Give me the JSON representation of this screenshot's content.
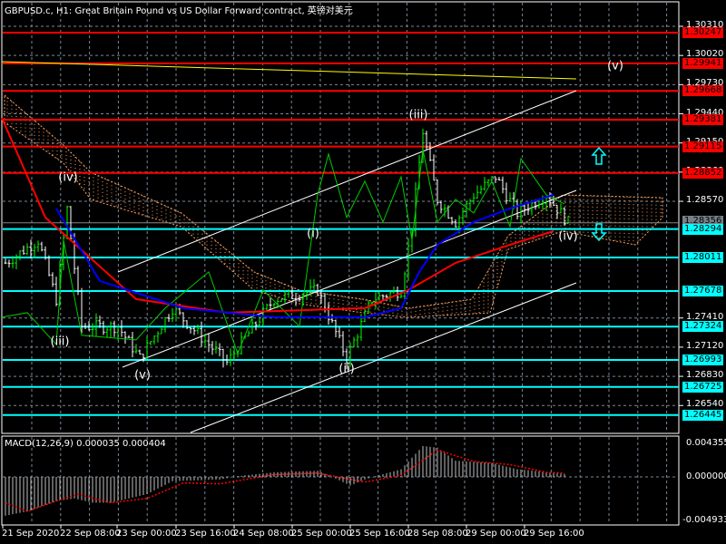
{
  "header": {
    "title": "GBPUSD.c, H1:  Great Britain Pound vs US Dollar Forward contract, 英镑对美元"
  },
  "colors": {
    "resistance": "#ff0000",
    "support": "#00ffff",
    "up_bar": "#00ff00",
    "down_bar": "#ffffff",
    "ma_slow": "#ff0000",
    "ma_fast": "#0000ff",
    "cloud": "#ffa060",
    "trendline": "#ffff00"
  },
  "price_axis": {
    "ticks": [
      "1.30310",
      "1.30020",
      "1.29730",
      "1.29440",
      "1.29150",
      "1.28860",
      "1.28570",
      "1.27410",
      "1.27120",
      "1.26830",
      "1.26540"
    ],
    "resistance_levels": [
      "1.30247",
      "1.29941",
      "1.29668",
      "1.29381",
      "1.29115",
      "1.28852"
    ],
    "support_levels": [
      "1.28294",
      "1.28011",
      "1.27678",
      "1.27324",
      "1.26993",
      "1.26725",
      "1.26445"
    ],
    "current_price": "1.28356"
  },
  "time_axis": [
    "21 Sep 2020",
    "22 Sep 08:00",
    "23 Sep 00:00",
    "23 Sep 16:00",
    "24 Sep 08:00",
    "25 Sep 00:00",
    "25 Sep 16:00",
    "28 Sep 08:00",
    "29 Sep 00:00",
    "29 Sep 16:00"
  ],
  "waves": [
    "(iv)",
    "(iii)",
    "(v)",
    "(i)",
    "(ii)",
    "(iii)",
    "(iv)",
    "(v)"
  ],
  "macd": {
    "label": "MACD(12,26,9) 0.000035 0.000404",
    "max": "0.004355",
    "min": "-0.004933",
    "zero": "0.000000"
  },
  "chart_data": {
    "type": "line",
    "price_path": [
      [
        1,
        1.27957
      ],
      [
        10,
        1.28183
      ],
      [
        15,
        1.27597
      ],
      [
        18,
        1.28498
      ],
      [
        22,
        1.27326
      ],
      [
        32,
        1.27326
      ],
      [
        38,
        1.27011
      ],
      [
        47,
        1.27507
      ],
      [
        62,
        1.26966
      ],
      [
        75,
        1.27597
      ],
      [
        87,
        1.27687
      ],
      [
        95,
        1.27011
      ],
      [
        102,
        1.27597
      ],
      [
        110,
        1.27687
      ],
      [
        113,
        1.28318
      ],
      [
        116,
        1.29264
      ],
      [
        120,
        1.28588
      ],
      [
        125,
        1.28363
      ],
      [
        130,
        1.28633
      ],
      [
        136,
        1.28814
      ],
      [
        142,
        1.28453
      ],
      [
        150,
        1.28633
      ],
      [
        156,
        1.28363
      ]
    ],
    "ma_slow": [
      [
        0,
        1.294
      ],
      [
        12,
        1.28409
      ],
      [
        37,
        1.27598
      ],
      [
        62,
        1.27463
      ],
      [
        100,
        1.27508
      ],
      [
        112,
        1.27688
      ],
      [
        125,
        1.27958
      ],
      [
        140,
        1.28138
      ],
      [
        152,
        1.28274
      ]
    ],
    "ma_fast": [
      [
        15,
        1.28499
      ],
      [
        27,
        1.27778
      ],
      [
        50,
        1.27508
      ],
      [
        75,
        1.27418
      ],
      [
        100,
        1.27418
      ],
      [
        110,
        1.27508
      ],
      [
        115,
        1.27868
      ],
      [
        120,
        1.28138
      ],
      [
        130,
        1.28363
      ],
      [
        140,
        1.28499
      ],
      [
        152,
        1.28634
      ]
    ],
    "oscillator": [
      [
        0,
        1.27418
      ],
      [
        7,
        1.27463
      ],
      [
        15,
        1.27147
      ],
      [
        17,
        1.28184
      ],
      [
        22,
        1.27238
      ],
      [
        37,
        1.27193
      ],
      [
        45,
        1.27508
      ],
      [
        57,
        1.27868
      ],
      [
        65,
        1.27057
      ],
      [
        72,
        1.27688
      ],
      [
        82,
        1.27328
      ],
      [
        87,
        1.28634
      ],
      [
        90,
        1.2904
      ],
      [
        95,
        1.28409
      ],
      [
        100,
        1.28769
      ],
      [
        105,
        1.28364
      ],
      [
        110,
        1.28814
      ],
      [
        113,
        1.28184
      ],
      [
        116,
        1.29085
      ],
      [
        120,
        1.28364
      ],
      [
        125,
        1.28589
      ],
      [
        130,
        1.28454
      ],
      [
        135,
        1.28769
      ],
      [
        140,
        1.28319
      ],
      [
        143,
        1.28995
      ],
      [
        150,
        1.28634
      ],
      [
        155,
        1.28544
      ]
    ],
    "macd_hist": [
      [
        1,
        -0.0045
      ],
      [
        7,
        -0.004
      ],
      [
        15,
        -0.0028
      ],
      [
        20,
        -0.0025
      ],
      [
        25,
        -0.003
      ],
      [
        30,
        -0.003
      ],
      [
        40,
        -0.002
      ],
      [
        47,
        -0.0005
      ],
      [
        60,
        -0.0003
      ],
      [
        65,
        0.0001
      ],
      [
        75,
        0.0006
      ],
      [
        87,
        0.0008
      ],
      [
        96,
        -0.001
      ],
      [
        100,
        -0.0003
      ],
      [
        110,
        0.001
      ],
      [
        116,
        0.004
      ],
      [
        120,
        0.0038
      ],
      [
        125,
        0.0021
      ],
      [
        135,
        0.0018
      ],
      [
        142,
        0.001
      ],
      [
        155,
        0.0004
      ]
    ],
    "macd_signal": [
      [
        1,
        -0.003
      ],
      [
        7,
        -0.004
      ],
      [
        15,
        -0.0028
      ],
      [
        21,
        -0.002
      ],
      [
        30,
        -0.003
      ],
      [
        40,
        -0.0025
      ],
      [
        50,
        -0.0007
      ],
      [
        60,
        -0.0008
      ],
      [
        75,
        0.0003
      ],
      [
        87,
        0.0005
      ],
      [
        100,
        -0.0006
      ],
      [
        110,
        0.0002
      ],
      [
        120,
        0.0035
      ],
      [
        130,
        0.002
      ],
      [
        140,
        0.0016
      ],
      [
        150,
        0.0006
      ],
      [
        155,
        0.0005
      ]
    ]
  }
}
